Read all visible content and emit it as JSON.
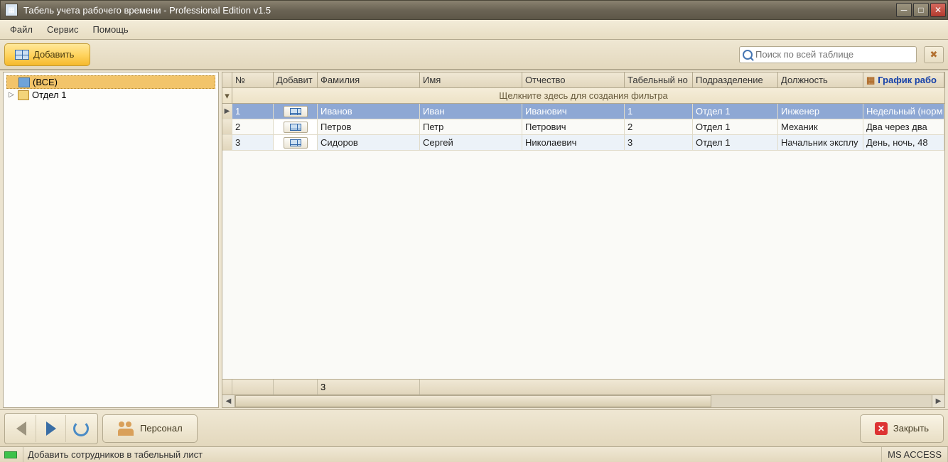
{
  "titlebar": {
    "title": "Табель учета рабочего времени - Professional Edition v1.5"
  },
  "menu": {
    "file": "Файл",
    "service": "Сервис",
    "help": "Помощь"
  },
  "toolbar": {
    "add_label": "Добавить",
    "search_placeholder": "Поиск по всей таблице"
  },
  "tree": {
    "all": "(ВСЕ)",
    "dept1": "Отдел 1"
  },
  "grid": {
    "headers": {
      "num": "№",
      "add": "Добавит",
      "surname": "Фамилия",
      "name": "Имя",
      "patronymic": "Отчество",
      "tabnum": "Табельный но",
      "dept": "Подразделение",
      "position": "Должность",
      "schedule": "График рабо"
    },
    "filter_hint": "Щелкните здесь для создания фильтра",
    "rows": [
      {
        "num": "1",
        "surname": "Иванов",
        "name": "Иван",
        "patronymic": "Иванович",
        "tabnum": "1",
        "dept": "Отдел 1",
        "position": "Инженер",
        "schedule": "Недельный (норм"
      },
      {
        "num": "2",
        "surname": "Петров",
        "name": "Петр",
        "patronymic": "Петрович",
        "tabnum": "2",
        "dept": "Отдел 1",
        "position": "Механик",
        "schedule": "Два через два"
      },
      {
        "num": "3",
        "surname": "Сидоров",
        "name": "Сергей",
        "patronymic": "Николаевич",
        "tabnum": "3",
        "dept": "Отдел 1",
        "position": "Начальник эксплу",
        "schedule": "День, ночь, 48"
      }
    ],
    "footer_count": "3"
  },
  "bottom": {
    "personnel": "Персонал",
    "close": "Закрыть"
  },
  "status": {
    "hint": "Добавить сотрудников в табельный лист",
    "db": "MS ACCESS"
  }
}
